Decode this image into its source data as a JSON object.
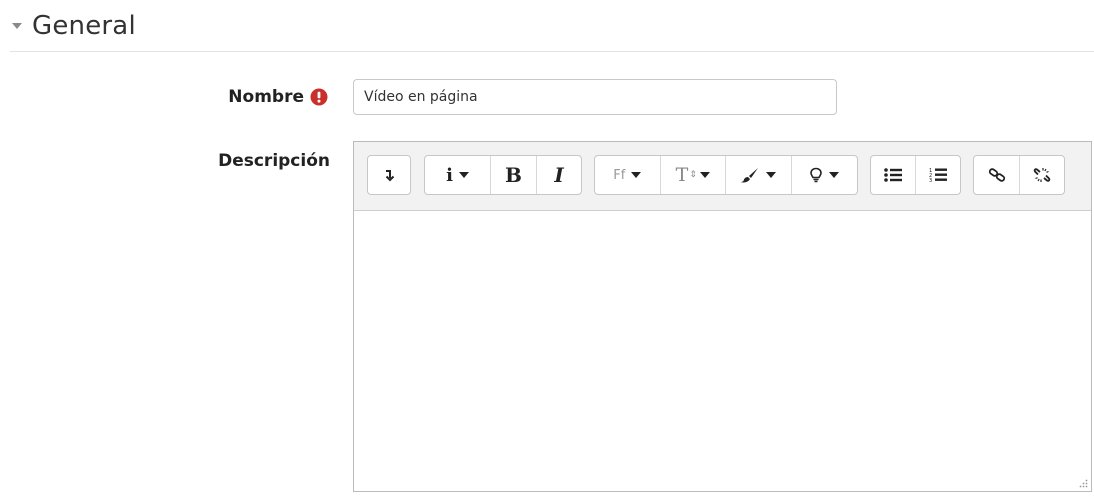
{
  "section": {
    "title": "General",
    "collapse_icon": "caret-down-icon"
  },
  "fields": {
    "name": {
      "label": "Nombre",
      "value": "Vídeo en página",
      "required_icon": "exclamation-circle-icon",
      "required_color": "#c9302c"
    },
    "description": {
      "label": "Descripción",
      "value": ""
    }
  },
  "toolbar": {
    "groups": [
      [
        "show-more-icon"
      ],
      [
        "info-style-icon",
        "bold-icon",
        "italic-icon"
      ],
      [
        "font-family-icon",
        "font-size-icon",
        "color-brush-icon",
        "bulb-icon"
      ],
      [
        "unordered-list-icon",
        "ordered-list-icon"
      ],
      [
        "link-icon",
        "unlink-icon"
      ]
    ],
    "font_family_glyph": "Ff",
    "font_size_glyph": "T",
    "bold_glyph": "B",
    "italic_glyph": "I",
    "info_glyph": "i"
  }
}
